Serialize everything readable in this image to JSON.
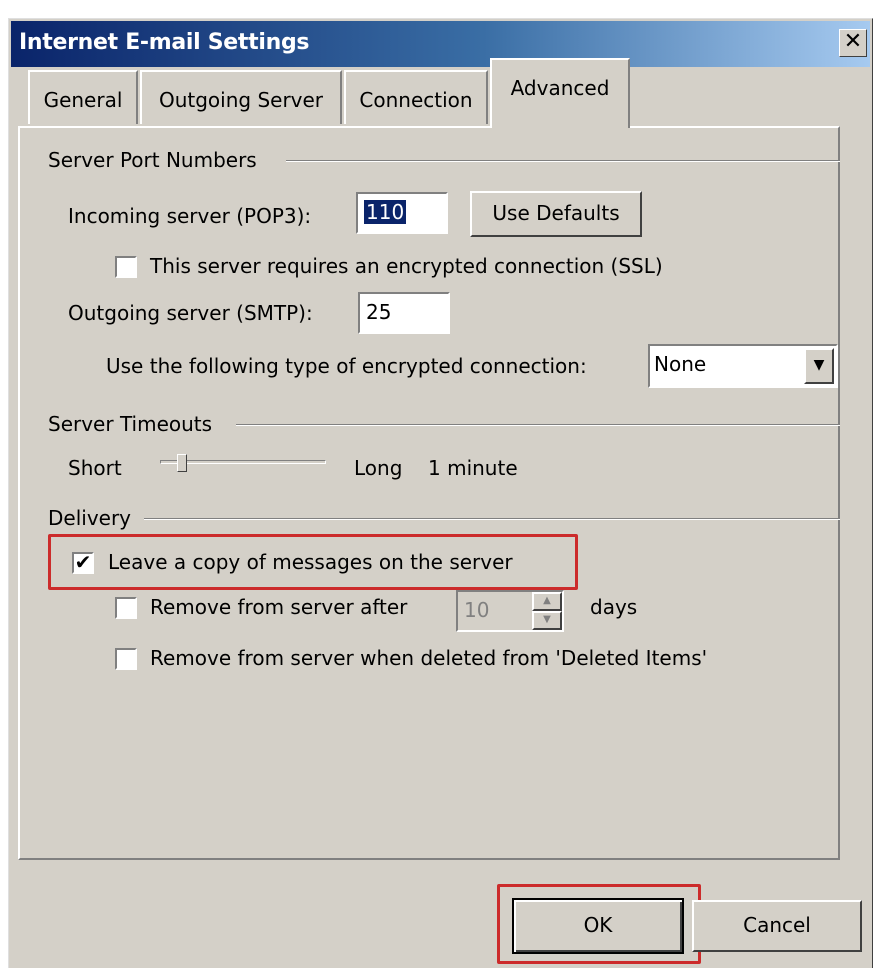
{
  "window": {
    "title": "Internet E-mail Settings",
    "close_glyph": "✕"
  },
  "tabs": [
    {
      "label": "General"
    },
    {
      "label": "Outgoing Server"
    },
    {
      "label": "Connection"
    },
    {
      "label": "Advanced"
    }
  ],
  "ports": {
    "group_label": "Server Port Numbers",
    "incoming_label": "Incoming server (POP3):",
    "incoming_value": "110",
    "use_defaults_label": "Use Defaults",
    "ssl_label": "This server requires an encrypted connection (SSL)",
    "ssl_checked": false,
    "outgoing_label": "Outgoing server (SMTP):",
    "outgoing_value": "25",
    "encryption_label": "Use the following type of encrypted connection:",
    "encryption_value": "None"
  },
  "timeouts": {
    "group_label": "Server Timeouts",
    "short_label": "Short",
    "long_label": "Long",
    "value_label": "1 minute",
    "level_fraction": 0.1
  },
  "delivery": {
    "group_label": "Delivery",
    "leave_copy_label": "Leave a copy of messages on the server",
    "leave_copy_checked": true,
    "remove_after_label": "Remove from server after",
    "remove_after_checked": false,
    "remove_after_days": "10",
    "days_label": "days",
    "remove_deleted_label": "Remove from server when deleted from 'Deleted Items'",
    "remove_deleted_checked": false
  },
  "buttons": {
    "ok_label": "OK",
    "cancel_label": "Cancel"
  },
  "colors": {
    "highlight": "#cc2b2b",
    "titlebar_start": "#0a246a"
  }
}
